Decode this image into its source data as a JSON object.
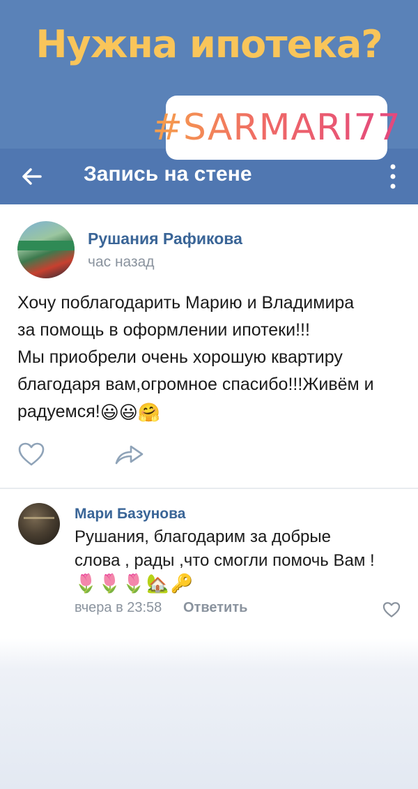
{
  "banner": {
    "headline": "Нужна ипотека?",
    "hashtag": "#SARMARI77"
  },
  "navbar": {
    "title": "Запись на стене",
    "back_icon": "arrow-left-icon",
    "menu_icon": "more-vertical-icon"
  },
  "post": {
    "author": "Рушания Рафикова",
    "time": "час назад",
    "lines": [
      "Хочу поблагодарить Марию и Владимира",
      "за помощь в оформлении ипотеки!!!",
      "Мы приобрели очень хорошую квартиру",
      "благодаря вам,огромное спасибо!!!Живём и",
      "радуемся!"
    ],
    "emojis": "😃😃🤗",
    "actions": {
      "like_icon": "heart-icon",
      "share_icon": "share-arrow-icon"
    }
  },
  "comment": {
    "author": "Мари Базунова",
    "lines": [
      "Рушания, благодарим за добрые",
      "слова , рады ,что смогли помочь Вам !"
    ],
    "emojis": "🌷🌷🌷🏡🔑",
    "time": "вчера в 23:58",
    "reply_label": "Ответить",
    "like_icon": "heart-icon"
  },
  "colors": {
    "banner_bg": "#5a82b8",
    "navbar_bg": "#5077b1",
    "headline": "#f9c55a",
    "link_blue": "#3a6597",
    "meta_gray": "#8a939e"
  }
}
